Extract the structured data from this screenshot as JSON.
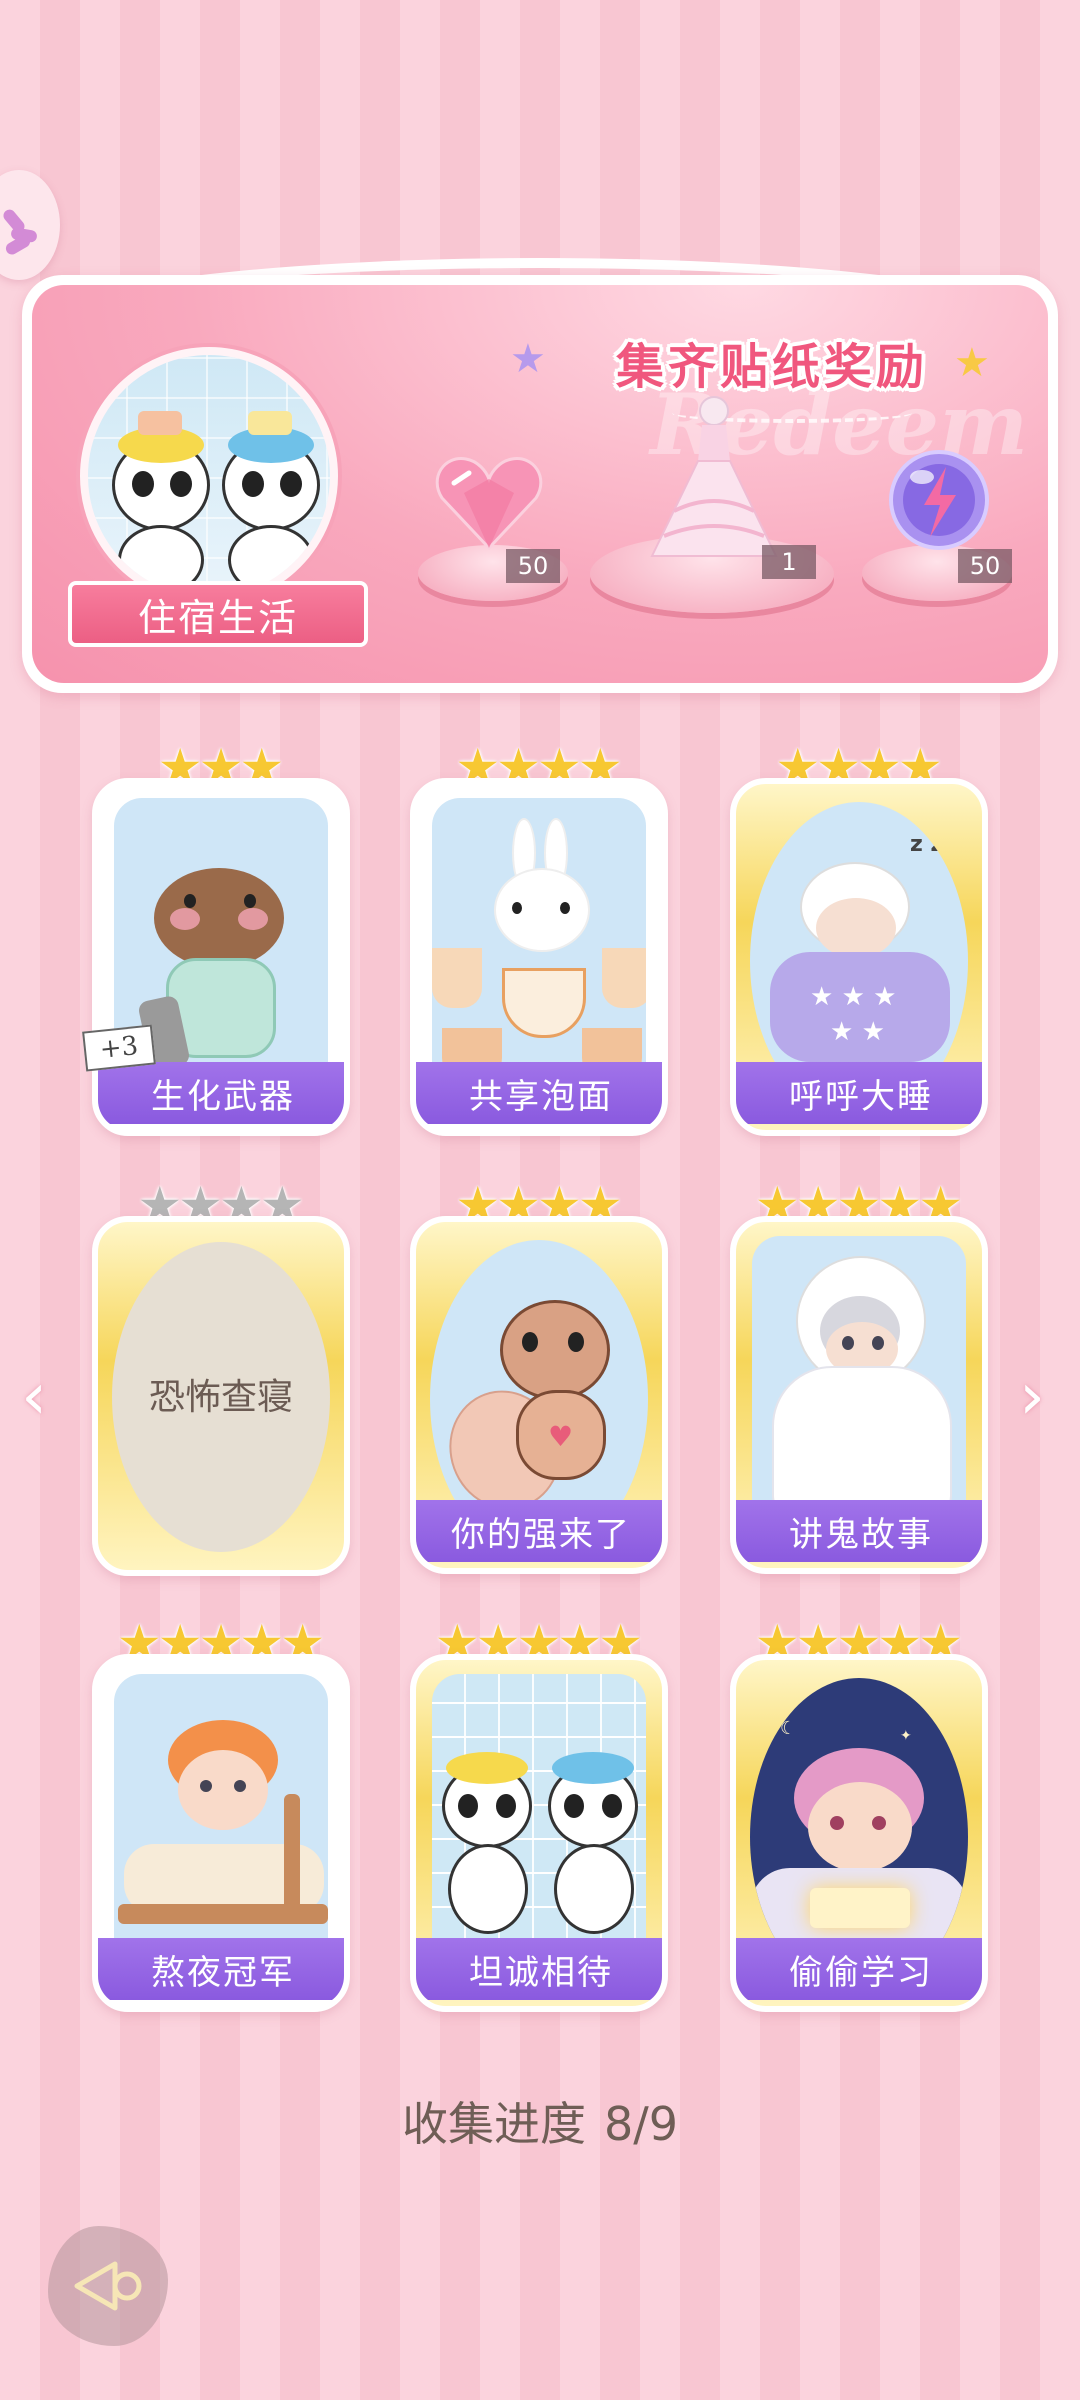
{
  "banner": {
    "title": "集齐贴纸奖励",
    "watermark": "Redeem",
    "album_name": "住宿生活",
    "rewards": [
      {
        "icon": "pink-heart-gem-icon",
        "count": "50"
      },
      {
        "icon": "dress-outfit-icon",
        "count": "1"
      },
      {
        "icon": "energy-orb-icon",
        "count": "50"
      }
    ]
  },
  "cards": [
    {
      "label": "生化武器",
      "stars": 3,
      "collected": true,
      "extra_tag": "+3",
      "art": "capybara-in-pajamas"
    },
    {
      "label": "共享泡面",
      "stars": 4,
      "collected": true,
      "art": "bunny-with-noodles"
    },
    {
      "label": "呼呼大睡",
      "stars": 4,
      "collected": true,
      "art": "boy-sleeping-in-bed"
    },
    {
      "label": "恐怖查寝",
      "stars": 4,
      "collected": false,
      "art": "locked"
    },
    {
      "label": "你的强来了",
      "stars": 4,
      "collected": true,
      "art": "cockroach"
    },
    {
      "label": "讲鬼故事",
      "stars": 5,
      "collected": true,
      "art": "boy-in-ghost-sheet"
    },
    {
      "label": "熬夜冠军",
      "stars": 5,
      "collected": true,
      "art": "boy-gaming-in-bed"
    },
    {
      "label": "坦诚相待",
      "stars": 5,
      "collected": true,
      "art": "pandas-in-shower"
    },
    {
      "label": "偷偷学习",
      "stars": 5,
      "collected": true,
      "art": "boy-reading-under-blanket"
    }
  ],
  "progress": {
    "label": "收集进度",
    "value": "8/9"
  },
  "nav": {
    "prev_icon": "chevron-left-icon",
    "next_icon": "chevron-right-icon"
  },
  "colors": {
    "accent_purple": "#8a5adf",
    "banner_pink": "#f692ad",
    "star_gold": "#f7c832",
    "star_grey": "#b5b5b5"
  }
}
